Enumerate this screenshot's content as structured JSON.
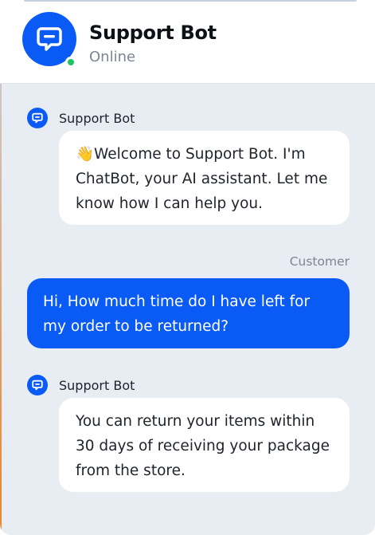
{
  "header": {
    "title": "Support Bot",
    "status": "Online",
    "avatar_icon": "chat-bubble-icon",
    "status_color": "#1ec163"
  },
  "messages": [
    {
      "sender": "Support Bot",
      "role": "bot",
      "text": "👋Welcome to Support Bot. I'm ChatBot, your AI assistant. Let me know how I can help you."
    },
    {
      "sender": "Customer",
      "role": "user",
      "text": "Hi, How much time do I have left for my order to be returned?"
    },
    {
      "sender": "Support Bot",
      "role": "bot",
      "text": "You can return your items within 30 days of receiving your package from the store."
    }
  ],
  "colors": {
    "accent": "#0a5bf5",
    "chat_background": "#e8ecf3",
    "bot_bubble": "#ffffff"
  }
}
